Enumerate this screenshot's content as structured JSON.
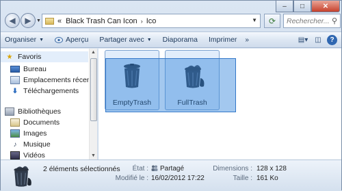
{
  "window": {
    "controls": {
      "minimize": "–",
      "maximize": "□",
      "close": "✕"
    }
  },
  "address": {
    "prefix": "«",
    "crumbs": [
      "Black Trash Can Icon",
      "Ico"
    ],
    "separator": "›"
  },
  "search": {
    "placeholder": "Rechercher..."
  },
  "toolbar": {
    "organiser": "Organiser",
    "apercu": "Aperçu",
    "partager": "Partager avec",
    "diaporama": "Diaporama",
    "imprimer": "Imprimer",
    "more": "»"
  },
  "navpane": {
    "favoris": "Favoris",
    "bureau": "Bureau",
    "emplacements": "Emplacements récents",
    "telechargements": "Téléchargements",
    "bibliotheques": "Bibliothèques",
    "documents": "Documents",
    "images": "Images",
    "musique": "Musique",
    "videos": "Vidéos"
  },
  "files": [
    {
      "name": "EmptyTrash"
    },
    {
      "name": "FullTrash"
    }
  ],
  "status": {
    "count": "2 éléments sélectionnés",
    "etat_label": "État :",
    "etat_value": "Partagé",
    "modifie_label": "Modifié le :",
    "modifie_value": "16/02/2012 17:22",
    "dimensions_label": "Dimensions :",
    "dimensions_value": "128 x 128",
    "taille_label": "Taille :",
    "taille_value": "161 Ko"
  },
  "colors": {
    "selection": "#3385dc",
    "accent": "#1e395b",
    "close_button": "#c7402b"
  }
}
